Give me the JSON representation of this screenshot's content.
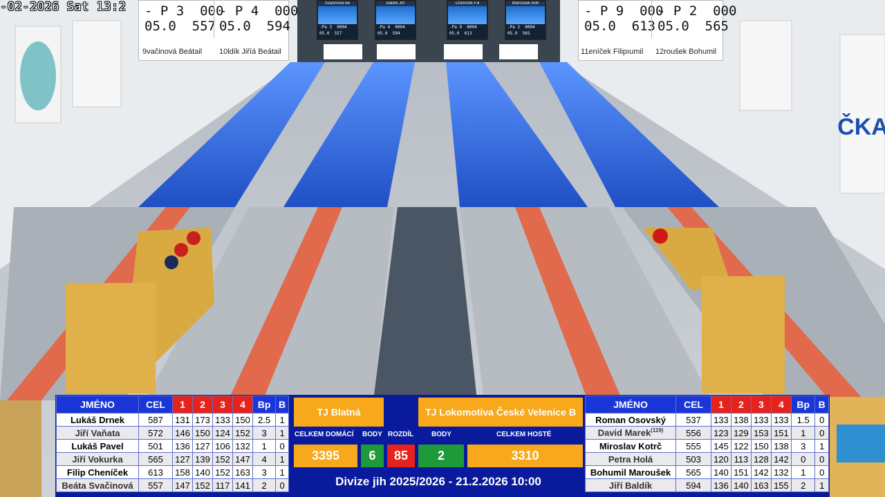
{
  "timestamp": "-02-2026 Sat 13:2",
  "lanes": [
    {
      "a": "- P 3  000",
      "b": "05.0  557",
      "name": "9vačinová Beátail"
    },
    {
      "a": "- P 4  000",
      "b": "05.0  594",
      "name": "10ldík Jiříá Beátail"
    },
    {
      "a": "- P 9  000",
      "b": "05.0  613",
      "name": "11eníček Filipıumil"
    },
    {
      "a": "- P 2  000",
      "b": "05.0  565",
      "name": "12roušek Bohumil"
    }
  ],
  "monitors": [
    {
      "hdr": "Svačinová Be",
      "n1": "-Pa 3  0004",
      "n2": "05.0  557"
    },
    {
      "hdr": "Baldík Jiří",
      "n1": "-Pa 4  0004",
      "n2": "05.0  594"
    },
    {
      "hdr": "Cheníček Fili",
      "n1": "-Pa 9  0004",
      "n2": "05.0  613"
    },
    {
      "hdr": "Maroušek Boh",
      "n1": "-Pa 2  0004",
      "n2": "05.0  565"
    }
  ],
  "logo_text": "ČKA",
  "headers": {
    "name": "JMÉNO",
    "cel": "CEL",
    "c1": "1",
    "c2": "2",
    "c3": "3",
    "c4": "4",
    "bp": "Bp",
    "b": "B"
  },
  "home_players": [
    {
      "name": "Lukáš Drnek",
      "cel": "587",
      "r1": "131",
      "r2": "173",
      "r3": "133",
      "r4": "150",
      "bp": "2.5",
      "b": "1"
    },
    {
      "name": "Jiří Vaňata",
      "cel": "572",
      "r1": "146",
      "r2": "150",
      "r3": "124",
      "r4": "152",
      "bp": "3",
      "b": "1"
    },
    {
      "name": "Lukáš Pavel",
      "cel": "501",
      "r1": "136",
      "r2": "127",
      "r3": "106",
      "r4": "132",
      "bp": "1",
      "b": "0"
    },
    {
      "name": "Jiří Vokurka",
      "cel": "565",
      "r1": "127",
      "r2": "139",
      "r3": "152",
      "r4": "147",
      "bp": "4",
      "b": "1"
    },
    {
      "name": "Filip Cheníček",
      "cel": "613",
      "r1": "158",
      "r2": "140",
      "r3": "152",
      "r4": "163",
      "bp": "3",
      "b": "1"
    },
    {
      "name": "Beáta Svačinová",
      "cel": "557",
      "r1": "147",
      "r2": "152",
      "r3": "117",
      "r4": "141",
      "bp": "2",
      "b": "0"
    }
  ],
  "guest_players": [
    {
      "name": "Roman Osovský",
      "cel": "537",
      "r1": "133",
      "r2": "138",
      "r3": "133",
      "r4": "133",
      "bp": "1.5",
      "b": "0"
    },
    {
      "name": "David Marek",
      "sup": "(119)",
      "cel": "556",
      "r1": "123",
      "r2": "129",
      "r3": "153",
      "r4": "151",
      "bp": "1",
      "b": "0"
    },
    {
      "name": "Miroslav Kotrč",
      "cel": "555",
      "r1": "145",
      "r2": "122",
      "r3": "150",
      "r4": "138",
      "bp": "3",
      "b": "1"
    },
    {
      "name": "Petra Holá",
      "cel": "503",
      "r1": "120",
      "r2": "113",
      "r3": "128",
      "r4": "142",
      "bp": "0",
      "b": "0"
    },
    {
      "name": "Bohumil Maroušek",
      "cel": "565",
      "r1": "140",
      "r2": "151",
      "r3": "142",
      "r4": "132",
      "bp": "1",
      "b": "0"
    },
    {
      "name": "Jiří Baldík",
      "cel": "594",
      "r1": "136",
      "r2": "140",
      "r3": "163",
      "r4": "155",
      "bp": "2",
      "b": "1"
    }
  ],
  "center": {
    "home_team": "TJ Blatná",
    "guest_team": "TJ Lokomotiva České Velenice B",
    "lbl_home_total": "CELKEM DOMÁCÍ",
    "lbl_points": "BODY",
    "lbl_diff": "ROZDÍL",
    "lbl_points2": "BODY",
    "lbl_guest_total": "CELKEM HOSTÉ",
    "home_total": "3395",
    "home_points": "6",
    "diff": "85",
    "guest_points": "2",
    "guest_total": "3310",
    "footer": "Divize jih 2025/2026 - 21.2.2026 10:00"
  },
  "colors": {
    "board": "#0a1a9c",
    "header": "#1a36d8",
    "round_header": "#e5231c",
    "team": "#f7a81b",
    "points": "#1f9a3a",
    "diff": "#e5231c"
  }
}
